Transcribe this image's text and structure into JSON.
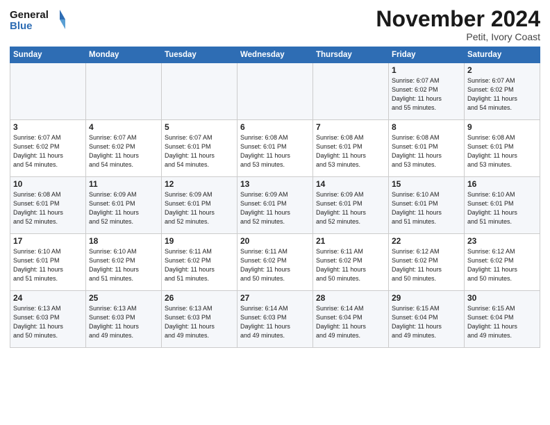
{
  "logo": {
    "line1": "General",
    "line2": "Blue"
  },
  "title": "November 2024",
  "subtitle": "Petit, Ivory Coast",
  "days_of_week": [
    "Sunday",
    "Monday",
    "Tuesday",
    "Wednesday",
    "Thursday",
    "Friday",
    "Saturday"
  ],
  "weeks": [
    [
      {
        "day": "",
        "info": ""
      },
      {
        "day": "",
        "info": ""
      },
      {
        "day": "",
        "info": ""
      },
      {
        "day": "",
        "info": ""
      },
      {
        "day": "",
        "info": ""
      },
      {
        "day": "1",
        "info": "Sunrise: 6:07 AM\nSunset: 6:02 PM\nDaylight: 11 hours\nand 55 minutes."
      },
      {
        "day": "2",
        "info": "Sunrise: 6:07 AM\nSunset: 6:02 PM\nDaylight: 11 hours\nand 54 minutes."
      }
    ],
    [
      {
        "day": "3",
        "info": "Sunrise: 6:07 AM\nSunset: 6:02 PM\nDaylight: 11 hours\nand 54 minutes."
      },
      {
        "day": "4",
        "info": "Sunrise: 6:07 AM\nSunset: 6:02 PM\nDaylight: 11 hours\nand 54 minutes."
      },
      {
        "day": "5",
        "info": "Sunrise: 6:07 AM\nSunset: 6:01 PM\nDaylight: 11 hours\nand 54 minutes."
      },
      {
        "day": "6",
        "info": "Sunrise: 6:08 AM\nSunset: 6:01 PM\nDaylight: 11 hours\nand 53 minutes."
      },
      {
        "day": "7",
        "info": "Sunrise: 6:08 AM\nSunset: 6:01 PM\nDaylight: 11 hours\nand 53 minutes."
      },
      {
        "day": "8",
        "info": "Sunrise: 6:08 AM\nSunset: 6:01 PM\nDaylight: 11 hours\nand 53 minutes."
      },
      {
        "day": "9",
        "info": "Sunrise: 6:08 AM\nSunset: 6:01 PM\nDaylight: 11 hours\nand 53 minutes."
      }
    ],
    [
      {
        "day": "10",
        "info": "Sunrise: 6:08 AM\nSunset: 6:01 PM\nDaylight: 11 hours\nand 52 minutes."
      },
      {
        "day": "11",
        "info": "Sunrise: 6:09 AM\nSunset: 6:01 PM\nDaylight: 11 hours\nand 52 minutes."
      },
      {
        "day": "12",
        "info": "Sunrise: 6:09 AM\nSunset: 6:01 PM\nDaylight: 11 hours\nand 52 minutes."
      },
      {
        "day": "13",
        "info": "Sunrise: 6:09 AM\nSunset: 6:01 PM\nDaylight: 11 hours\nand 52 minutes."
      },
      {
        "day": "14",
        "info": "Sunrise: 6:09 AM\nSunset: 6:01 PM\nDaylight: 11 hours\nand 52 minutes."
      },
      {
        "day": "15",
        "info": "Sunrise: 6:10 AM\nSunset: 6:01 PM\nDaylight: 11 hours\nand 51 minutes."
      },
      {
        "day": "16",
        "info": "Sunrise: 6:10 AM\nSunset: 6:01 PM\nDaylight: 11 hours\nand 51 minutes."
      }
    ],
    [
      {
        "day": "17",
        "info": "Sunrise: 6:10 AM\nSunset: 6:01 PM\nDaylight: 11 hours\nand 51 minutes."
      },
      {
        "day": "18",
        "info": "Sunrise: 6:10 AM\nSunset: 6:02 PM\nDaylight: 11 hours\nand 51 minutes."
      },
      {
        "day": "19",
        "info": "Sunrise: 6:11 AM\nSunset: 6:02 PM\nDaylight: 11 hours\nand 51 minutes."
      },
      {
        "day": "20",
        "info": "Sunrise: 6:11 AM\nSunset: 6:02 PM\nDaylight: 11 hours\nand 50 minutes."
      },
      {
        "day": "21",
        "info": "Sunrise: 6:11 AM\nSunset: 6:02 PM\nDaylight: 11 hours\nand 50 minutes."
      },
      {
        "day": "22",
        "info": "Sunrise: 6:12 AM\nSunset: 6:02 PM\nDaylight: 11 hours\nand 50 minutes."
      },
      {
        "day": "23",
        "info": "Sunrise: 6:12 AM\nSunset: 6:02 PM\nDaylight: 11 hours\nand 50 minutes."
      }
    ],
    [
      {
        "day": "24",
        "info": "Sunrise: 6:13 AM\nSunset: 6:03 PM\nDaylight: 11 hours\nand 50 minutes."
      },
      {
        "day": "25",
        "info": "Sunrise: 6:13 AM\nSunset: 6:03 PM\nDaylight: 11 hours\nand 49 minutes."
      },
      {
        "day": "26",
        "info": "Sunrise: 6:13 AM\nSunset: 6:03 PM\nDaylight: 11 hours\nand 49 minutes."
      },
      {
        "day": "27",
        "info": "Sunrise: 6:14 AM\nSunset: 6:03 PM\nDaylight: 11 hours\nand 49 minutes."
      },
      {
        "day": "28",
        "info": "Sunrise: 6:14 AM\nSunset: 6:04 PM\nDaylight: 11 hours\nand 49 minutes."
      },
      {
        "day": "29",
        "info": "Sunrise: 6:15 AM\nSunset: 6:04 PM\nDaylight: 11 hours\nand 49 minutes."
      },
      {
        "day": "30",
        "info": "Sunrise: 6:15 AM\nSunset: 6:04 PM\nDaylight: 11 hours\nand 49 minutes."
      }
    ]
  ]
}
